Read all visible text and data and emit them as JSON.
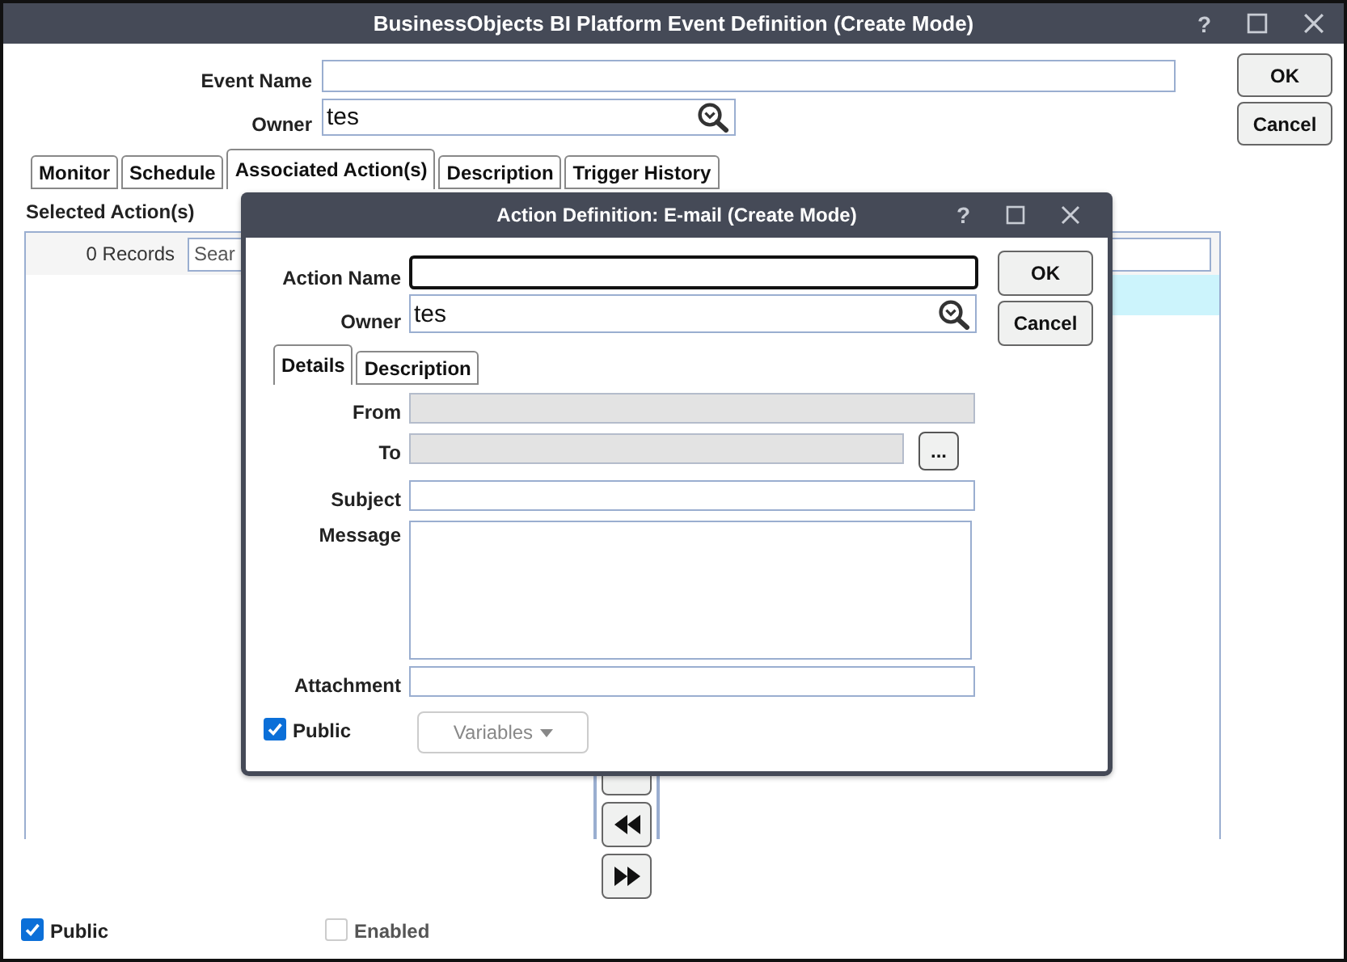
{
  "window": {
    "title": "BusinessObjects BI Platform Event Definition (Create Mode)",
    "help": "?"
  },
  "event_name": {
    "label": "Event Name"
  },
  "owner": {
    "label": "Owner",
    "value": "tes"
  },
  "buttons": [
    {
      "label": "OK"
    },
    {
      "label": "Cancel"
    }
  ],
  "tabs": [
    {
      "label": "Monitor",
      "selected": false
    },
    {
      "label": "Schedule",
      "selected": false
    },
    {
      "label": "Associated Action(s)",
      "selected": true
    },
    {
      "label": "Description",
      "selected": false
    },
    {
      "label": "Trigger History",
      "selected": false
    }
  ],
  "selected_actions": {
    "label": "Selected Action(s)",
    "count": "0 Records",
    "search_placeholder": "Sear"
  },
  "public": {
    "label": "Public",
    "checked": true
  },
  "enabled": {
    "label": "Enabled",
    "checked": false,
    "disabled": true
  },
  "dialog": {
    "title": "Action Definition: E-mail (Create Mode)",
    "help": "?",
    "action_name": {
      "label": "Action Name",
      "focused": true
    },
    "owner": {
      "label": "Owner",
      "value": "tes"
    },
    "buttons": [
      {
        "label": "OK"
      },
      {
        "label": "Cancel"
      }
    ],
    "tabs": [
      {
        "label": "Details",
        "selected": true
      },
      {
        "label": "Description",
        "selected": false
      }
    ],
    "fields": [
      {
        "kind": "text",
        "label": "From",
        "disabled": true
      },
      {
        "kind": "picker",
        "label": "To",
        "disabled": true,
        "button": "..."
      },
      {
        "kind": "text",
        "label": "Subject",
        "disabled": false
      },
      {
        "kind": "textarea",
        "label": "Message",
        "disabled": false
      },
      {
        "kind": "text",
        "label": "Attachment",
        "disabled": false
      }
    ],
    "public": {
      "label": "Public",
      "checked": true
    },
    "variables": {
      "label": "Variables",
      "disabled": true
    }
  }
}
